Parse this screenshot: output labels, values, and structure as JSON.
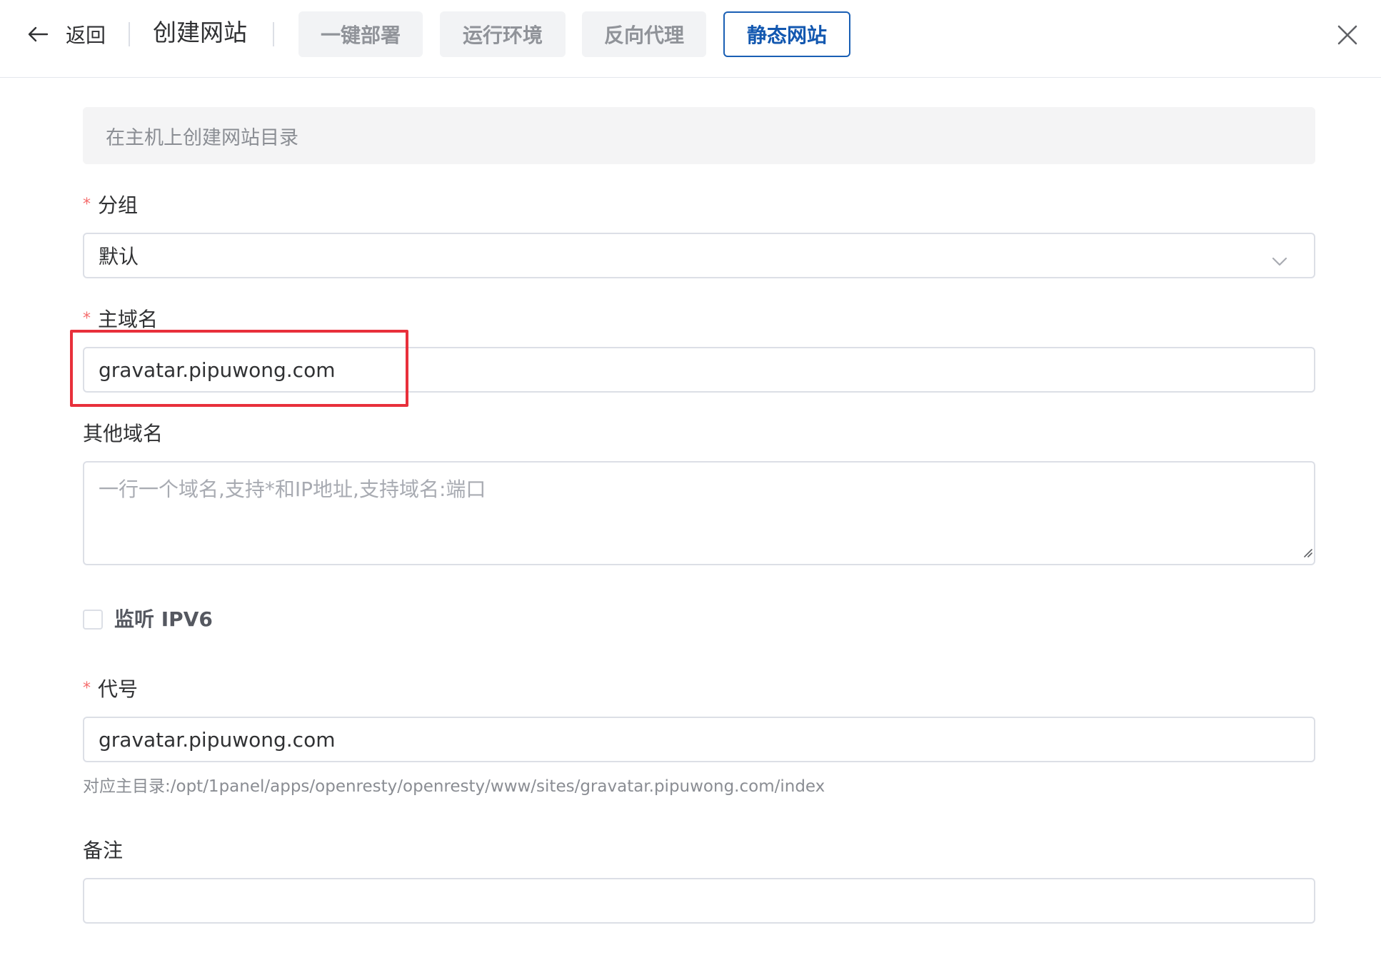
{
  "header": {
    "back_label": "返回",
    "title": "创建网站",
    "tabs": [
      {
        "label": "一键部署",
        "active": false
      },
      {
        "label": "运行环境",
        "active": false
      },
      {
        "label": "反向代理",
        "active": false
      },
      {
        "label": "静态网站",
        "active": true
      }
    ]
  },
  "form": {
    "info": "在主机上创建网站目录",
    "group": {
      "label": "分组",
      "required": true,
      "value": "默认"
    },
    "primary_domain": {
      "label": "主域名",
      "required": true,
      "value": "gravatar.pipuwong.com"
    },
    "other_domains": {
      "label": "其他域名",
      "placeholder": "一行一个域名,支持*和IP地址,支持域名:端口"
    },
    "ipv6": {
      "label": "监听 IPV6",
      "checked": false
    },
    "alias": {
      "label": "代号",
      "required": true,
      "value": "gravatar.pipuwong.com",
      "hint": "对应主目录:/opt/1panel/apps/openresty/openresty/www/sites/gravatar.pipuwong.com/index"
    },
    "remark": {
      "label": "备注",
      "value": ""
    }
  },
  "colors": {
    "accent": "#1358b0",
    "required_mark": "#f56c6c",
    "highlight_box": "#e8303b"
  }
}
